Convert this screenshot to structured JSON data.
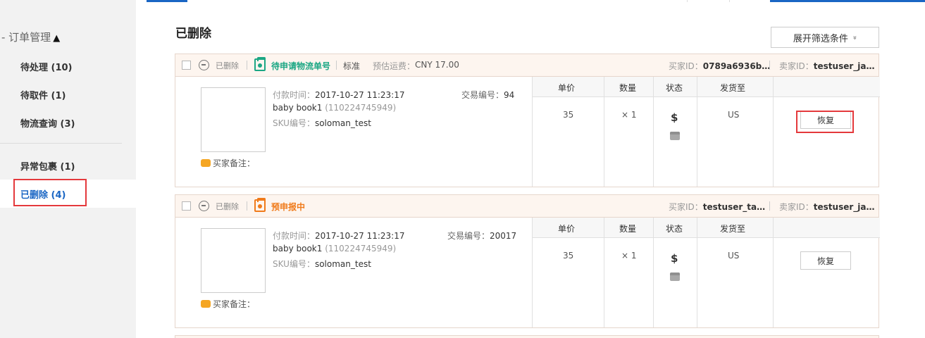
{
  "sidebar": {
    "heading": "- 订单管理",
    "heading_caret": "▲",
    "items": [
      {
        "label": "待处理 (10)"
      },
      {
        "label": "待取件 (1)"
      },
      {
        "label": "物流查询 (3)"
      },
      {
        "label": "异常包裹 (1)"
      },
      {
        "label": "已删除 (4)",
        "active": true
      }
    ]
  },
  "main": {
    "title": "已删除",
    "filter_button": "展开筛选条件",
    "filter_chevron": "»"
  },
  "orders": [
    {
      "deleted_tag": "已删除",
      "status": "待申请物流单号",
      "status_color": "#1ba784",
      "service": "标准",
      "freight_label": "预估运费：",
      "freight_value": "CNY 17.00",
      "buyer_id_label": "买家ID：",
      "buyer_id": "0789a6936b…",
      "seller_id_label": "卖家ID：",
      "seller_id": "testuser_ja…",
      "pay_time_label": "付款时间：",
      "pay_time": "2017-10-27 11:23:17",
      "trade_no_label": "交易编号：",
      "trade_no": "94",
      "product_name": "baby book1",
      "product_id": "(110224745949)",
      "sku_label": "SKU编号：",
      "sku": "soloman_test",
      "memo_label": "买家备注：",
      "headers": {
        "price": "单价",
        "qty": "数量",
        "status": "状态",
        "ship_to": "发货至"
      },
      "price": "35",
      "qty": "× 1",
      "dollar": "$",
      "ship_to": "US",
      "restore_label": "恢复"
    },
    {
      "deleted_tag": "已删除",
      "status": "预申报中",
      "status_color": "#f07b1b",
      "buyer_id_label": "买家ID：",
      "buyer_id": "testuser_ta…",
      "seller_id_label": "卖家ID：",
      "seller_id": "testuser_ja…",
      "pay_time_label": "付款时间：",
      "pay_time": "2017-10-27 11:23:17",
      "trade_no_label": "交易编号：",
      "trade_no": "20017",
      "product_name": "baby book1",
      "product_id": "(110224745949)",
      "sku_label": "SKU编号：",
      "sku": "soloman_test",
      "memo_label": "买家备注：",
      "headers": {
        "price": "单价",
        "qty": "数量",
        "status": "状态",
        "ship_to": "发货至"
      },
      "price": "35",
      "qty": "× 1",
      "dollar": "$",
      "ship_to": "US",
      "restore_label": "恢复"
    }
  ],
  "colors": {
    "accent": "#1a66c4",
    "highlight_box": "#e4393c",
    "order_header_bg": "#fdf5ef"
  }
}
